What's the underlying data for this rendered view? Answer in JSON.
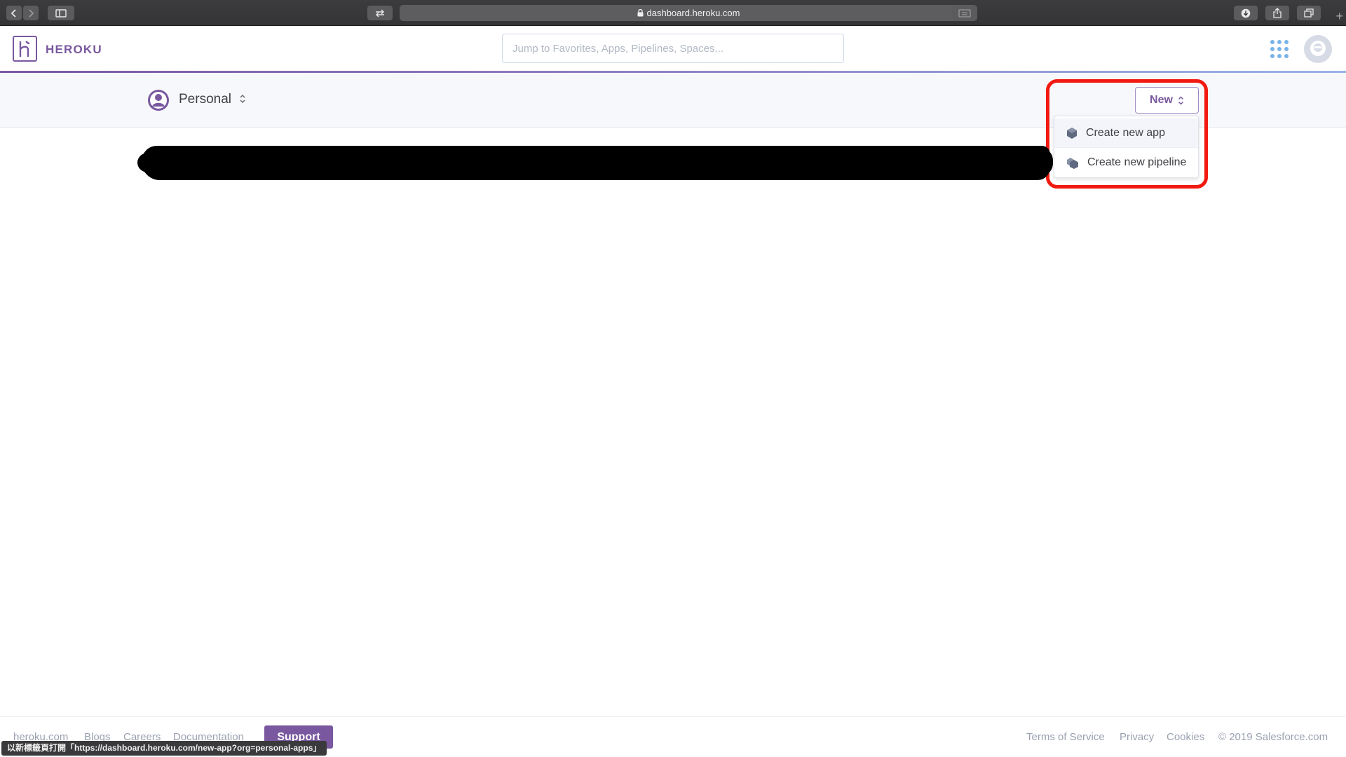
{
  "browser": {
    "url": "dashboard.heroku.com",
    "status_url": "以新標籤頁打開「https://dashboard.heroku.com/new-app?org=personal-apps」"
  },
  "header": {
    "brand": "HEROKU",
    "search_placeholder": "Jump to Favorites, Apps, Pipelines, Spaces..."
  },
  "account": {
    "name": "Personal"
  },
  "new_menu": {
    "button_label": "New",
    "items": [
      {
        "label": "Create new app",
        "icon": "app-hexagon-icon"
      },
      {
        "label": "Create new pipeline",
        "icon": "pipeline-hexagons-icon"
      }
    ]
  },
  "footer": {
    "left_links": [
      "heroku.com",
      "Blogs",
      "Careers",
      "Documentation"
    ],
    "support_label": "Support",
    "right_links": [
      "Terms of Service",
      "Privacy",
      "Cookies"
    ],
    "copyright": "© 2019 Salesforce.com"
  },
  "colors": {
    "brand_purple": "#79589f",
    "annotation_red": "#f21a10"
  }
}
